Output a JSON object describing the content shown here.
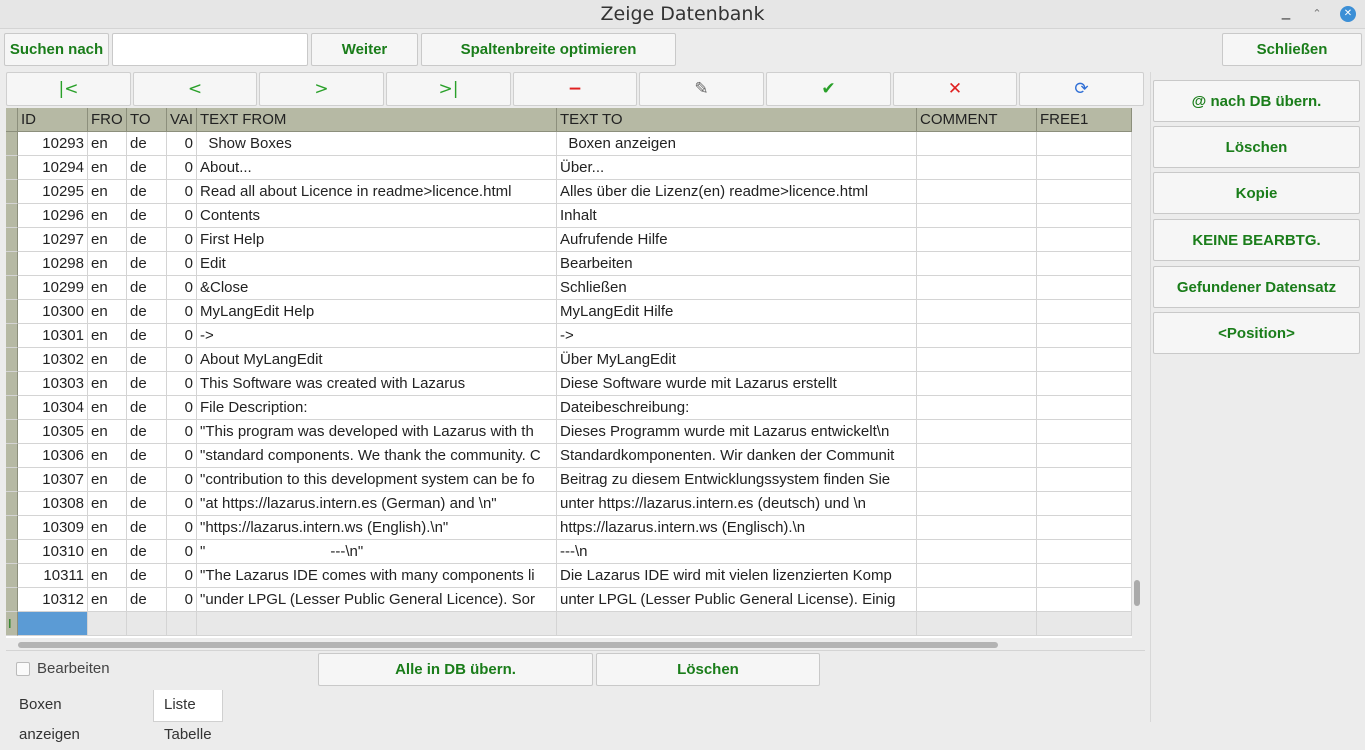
{
  "window": {
    "title": "Zeige Datenbank"
  },
  "toolbar": {
    "search_label": "Suchen nach",
    "search_value": "",
    "next_label": "Weiter",
    "optimize_label": "Spaltenbreite optimieren",
    "close_label": "Schließen"
  },
  "navigator": {
    "first": "|<",
    "prior": "<",
    "next": ">",
    "last": ">|",
    "delete": "−",
    "edit": "✎",
    "post": "✔",
    "cancel": "✕",
    "refresh": "⟳",
    "colors": {
      "green": "#2aa02a",
      "red": "#e02020",
      "gray": "#666666",
      "blue": "#2f6fd6"
    }
  },
  "grid": {
    "columns": [
      "ID",
      "FRO",
      "TO",
      "VAI",
      "TEXT FROM",
      "TEXT TO",
      "COMMENT",
      "FREE1"
    ],
    "rows": [
      [
        "10293",
        "en",
        "de",
        "0",
        "  Show Boxes",
        "  Boxen anzeigen",
        "",
        ""
      ],
      [
        "10294",
        "en",
        "de",
        "0",
        "About...",
        "Über...",
        "",
        ""
      ],
      [
        "10295",
        "en",
        "de",
        "0",
        "Read all about Licence in readme>licence.html",
        "Alles über die Lizenz(en) readme>licence.html",
        "",
        ""
      ],
      [
        "10296",
        "en",
        "de",
        "0",
        "Contents",
        "Inhalt",
        "",
        ""
      ],
      [
        "10297",
        "en",
        "de",
        "0",
        "First Help",
        "Aufrufende Hilfe",
        "",
        ""
      ],
      [
        "10298",
        "en",
        "de",
        "0",
        "Edit",
        "Bearbeiten",
        "",
        ""
      ],
      [
        "10299",
        "en",
        "de",
        "0",
        "&Close",
        "Schließen",
        "",
        ""
      ],
      [
        "10300",
        "en",
        "de",
        "0",
        "MyLangEdit Help",
        "MyLangEdit Hilfe",
        "",
        ""
      ],
      [
        "10301",
        "en",
        "de",
        "0",
        "->",
        "->",
        "",
        ""
      ],
      [
        "10302",
        "en",
        "de",
        "0",
        "About MyLangEdit",
        "Über MyLangEdit",
        "",
        ""
      ],
      [
        "10303",
        "en",
        "de",
        "0",
        "This Software was created with Lazarus",
        "Diese Software wurde mit Lazarus erstellt",
        "",
        ""
      ],
      [
        "10304",
        "en",
        "de",
        "0",
        "File Description:",
        "Dateibeschreibung:",
        "",
        ""
      ],
      [
        "10305",
        "en",
        "de",
        "0",
        "\"This program was developed with Lazarus with th",
        "Dieses Programm wurde mit Lazarus entwickelt\\n",
        "",
        ""
      ],
      [
        "10306",
        "en",
        "de",
        "0",
        "\"standard components. We thank the community. C",
        "Standardkomponenten. Wir danken der Communit",
        "",
        ""
      ],
      [
        "10307",
        "en",
        "de",
        "0",
        "\"contribution to this development system can be fo",
        "Beitrag zu diesem Entwicklungssystem finden Sie",
        "",
        ""
      ],
      [
        "10308",
        "en",
        "de",
        "0",
        "\"at https://lazarus.intern.es (German) and \\n\"",
        "unter https://lazarus.intern.es (deutsch) und \\n",
        "",
        ""
      ],
      [
        "10309",
        "en",
        "de",
        "0",
        "\"https://lazarus.intern.ws (English).\\n\"",
        "https://lazarus.intern.ws (Englisch).\\n",
        "",
        ""
      ],
      [
        "10310",
        "en",
        "de",
        "0",
        "\"                              ---\\n\"",
        "---\\n",
        "",
        ""
      ],
      [
        "10311",
        "en",
        "de",
        "0",
        "\"The Lazarus IDE comes with many components li",
        "Die Lazarus IDE wird mit vielen lizenzierten Komp",
        "",
        ""
      ],
      [
        "10312",
        "en",
        "de",
        "0",
        "\"under LPGL (Lesser Public General Licence). Sor",
        "unter LPGL (Lesser Public General License). Einig",
        "",
        ""
      ]
    ],
    "new_row_marker": "I"
  },
  "bottom": {
    "edit_checkbox_label": "Bearbeiten",
    "edit_checked": false,
    "apply_all_label": "Alle in DB übern.",
    "delete_label": "Löschen"
  },
  "tabs": [
    {
      "label": "Boxen anzeigen",
      "active": false
    },
    {
      "label": "Liste Tabelle",
      "active": true
    }
  ],
  "sidepanel": {
    "buttons": [
      "@ nach DB übern.",
      "Löschen",
      "Kopie",
      "KEINE BEARBTG.",
      "Gefundener Datensatz",
      "<Position>"
    ]
  }
}
